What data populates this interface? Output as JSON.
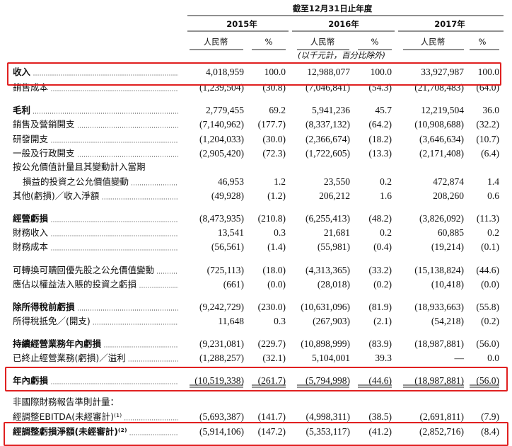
{
  "header": {
    "period": "截至12月31日止年度",
    "years": [
      "2015年",
      "2016年",
      "2017年"
    ],
    "col_rmb": "人民幣",
    "col_pct": "%",
    "unit_note": "(以千元計，百分比除外)"
  },
  "rows": [
    {
      "label": "收入",
      "bold": true,
      "dots": true,
      "v": [
        "4,018,959",
        "100.0",
        "12,988,077",
        "100.0",
        "33,927,987",
        "100.0"
      ]
    },
    {
      "label": "銷售成本",
      "dots": true,
      "v": [
        "(1,239,504)",
        "(30.8)",
        "(7,046,841)",
        "(54.3)",
        "(21,708,483)",
        "(64.0)"
      ]
    },
    {
      "label": "毛利",
      "bold": true,
      "dots": true,
      "v": [
        "2,779,455",
        "69.2",
        "5,941,236",
        "45.7",
        "12,219,504",
        "36.0"
      ]
    },
    {
      "label": "銷售及營銷開支",
      "dots": true,
      "v": [
        "(7,140,962)",
        "(177.7)",
        "(8,337,132)",
        "(64.2)",
        "(10,908,688)",
        "(32.2)"
      ]
    },
    {
      "label": "研發開支",
      "dots": true,
      "v": [
        "(1,204,033)",
        "(30.0)",
        "(2,366,674)",
        "(18.2)",
        "(3,646,634)",
        "(10.7)"
      ]
    },
    {
      "label": "一般及行政開支",
      "dots": true,
      "v": [
        "(2,905,420)",
        "(72.3)",
        "(1,722,605)",
        "(13.3)",
        "(2,171,408)",
        "(6.4)"
      ]
    },
    {
      "label": "按公允價值計量且其變動計入當期",
      "dots": false,
      "v": [
        "",
        "",
        "",
        "",
        "",
        ""
      ]
    },
    {
      "label": "損益的投資之公允價值變動",
      "indent": true,
      "dots": true,
      "v": [
        "46,953",
        "1.2",
        "23,550",
        "0.2",
        "472,874",
        "1.4"
      ]
    },
    {
      "label": "其他(虧損)／收入淨額",
      "dots": true,
      "v": [
        "(49,928)",
        "(1.2)",
        "206,212",
        "1.6",
        "208,260",
        "0.6"
      ]
    },
    {
      "label": "經營虧損",
      "bold": true,
      "dots": true,
      "v": [
        "(8,473,935)",
        "(210.8)",
        "(6,255,413)",
        "(48.2)",
        "(3,826,092)",
        "(11.3)"
      ]
    },
    {
      "label": "財務收入",
      "dots": true,
      "v": [
        "13,541",
        "0.3",
        "21,681",
        "0.2",
        "60,885",
        "0.2"
      ]
    },
    {
      "label": "財務成本",
      "dots": true,
      "v": [
        "(56,561)",
        "(1.4)",
        "(55,981)",
        "(0.4)",
        "(19,214)",
        "(0.1)"
      ]
    },
    {
      "label": "可轉換可贖回優先股之公允價值變動",
      "dots": true,
      "v": [
        "(725,113)",
        "(18.0)",
        "(4,313,365)",
        "(33.2)",
        "(15,138,824)",
        "(44.6)"
      ]
    },
    {
      "label": "應佔以權益法入賬的投資之虧損",
      "dots": true,
      "v": [
        "(661)",
        "(0.0)",
        "(28,018)",
        "(0.2)",
        "(10,418)",
        "(0.0)"
      ]
    },
    {
      "label": "除所得稅前虧損",
      "bold": true,
      "dots": true,
      "v": [
        "(9,242,729)",
        "(230.0)",
        "(10,631,096)",
        "(81.9)",
        "(18,933,663)",
        "(55.8)"
      ]
    },
    {
      "label": "所得稅抵免／(開支)",
      "dots": true,
      "v": [
        "11,648",
        "0.3",
        "(267,903)",
        "(2.1)",
        "(54,218)",
        "(0.2)"
      ]
    },
    {
      "label": "持續經營業務年內虧損",
      "bold": true,
      "dots": true,
      "v": [
        "(9,231,081)",
        "(229.7)",
        "(10,898,999)",
        "(83.9)",
        "(18,987,881)",
        "(56.0)"
      ]
    },
    {
      "label": "已終止經營業務(虧損)／溢利",
      "dots": true,
      "v": [
        "(1,288,257)",
        "(32.1)",
        "5,104,001",
        "39.3",
        "—",
        "0.0"
      ]
    },
    {
      "label": "年內虧損",
      "bold": true,
      "dots": true,
      "v": [
        "(10,519,338)",
        "(261.7)",
        "(5,794,998)",
        "(44.6)",
        "(18,987,881)",
        "(56.0)"
      ]
    },
    {
      "label": "非國際財務報告準則計量：",
      "dots": false,
      "v": [
        "",
        "",
        "",
        "",
        "",
        ""
      ]
    },
    {
      "label": "經調整EBITDA(未經審計)⁽¹⁾",
      "dots": true,
      "v": [
        "(5,693,387)",
        "(141.7)",
        "(4,998,311)",
        "(38.5)",
        "(2,691,811)",
        "(7.9)"
      ]
    },
    {
      "label": "經調整虧損淨額(未經審計)⁽²⁾",
      "bold": true,
      "dots": true,
      "v": [
        "(5,914,106)",
        "(147.2)",
        "(5,353,117)",
        "(41.2)",
        "(2,852,716)",
        "(8.4)"
      ]
    }
  ],
  "highlight_color": "#e02020"
}
